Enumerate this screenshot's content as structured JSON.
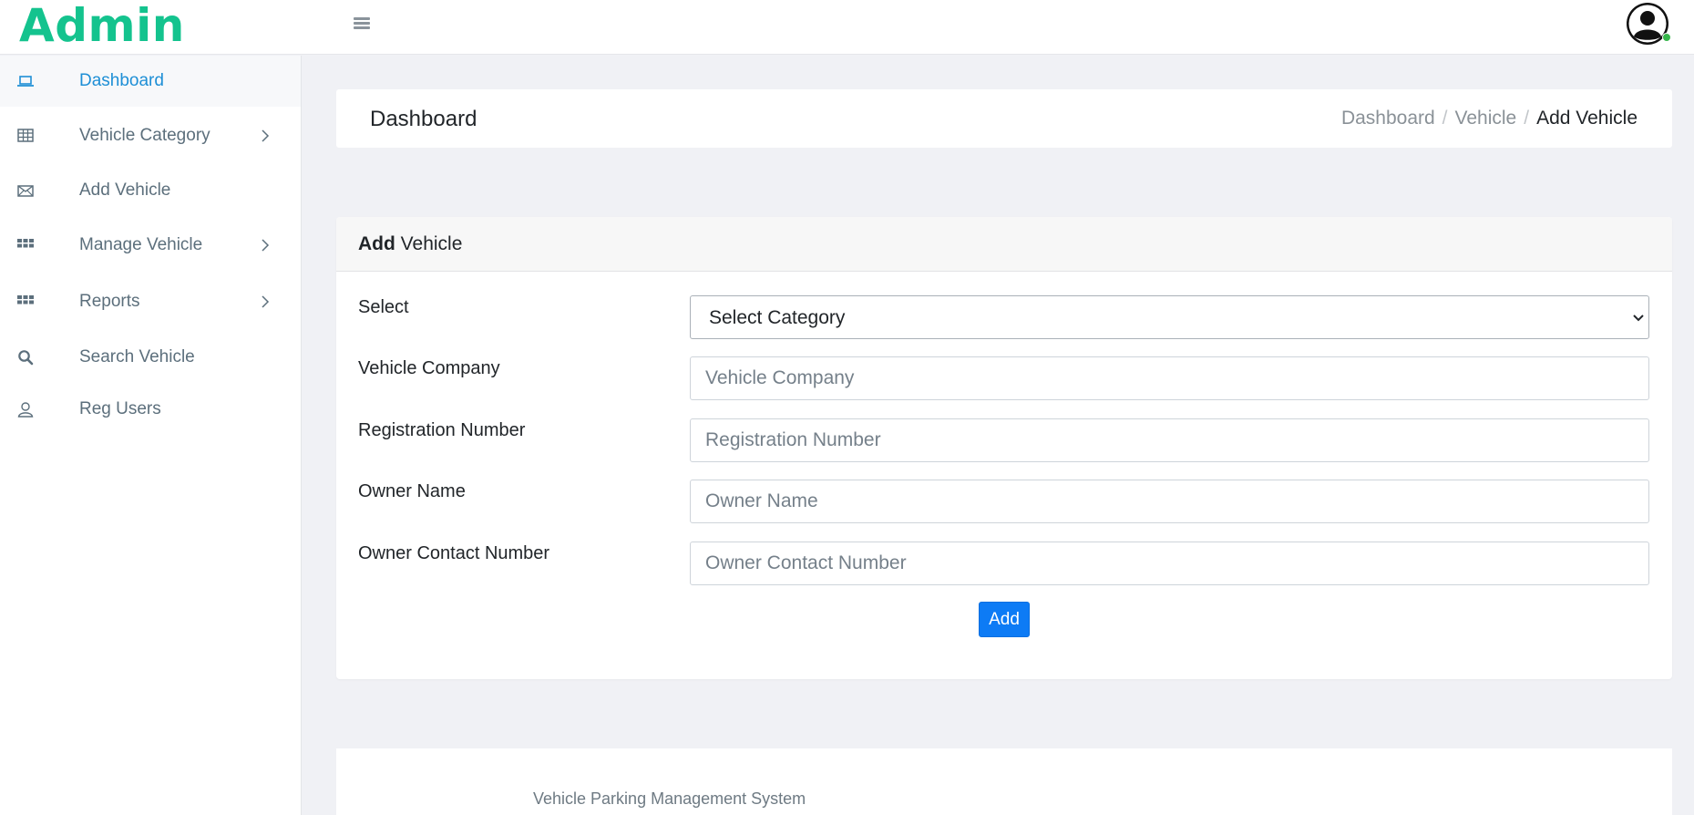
{
  "header": {
    "brand": "Admin",
    "menu_icon": "hamburger-icon",
    "avatar_icon": "user-avatar-icon"
  },
  "sidebar": {
    "items": [
      {
        "label": "Dashboard",
        "icon": "laptop-icon",
        "active": true
      },
      {
        "label": "Vehicle Category",
        "icon": "table-icon",
        "has_submenu": true
      },
      {
        "label": "Add Vehicle",
        "icon": "envelope-icon"
      },
      {
        "label": "Manage Vehicle",
        "icon": "grid-icon",
        "has_submenu": true
      },
      {
        "label": "Reports",
        "icon": "grid-icon",
        "has_submenu": true
      },
      {
        "label": "Search Vehicle",
        "icon": "search-icon"
      },
      {
        "label": "Reg Users",
        "icon": "user-icon"
      }
    ]
  },
  "page": {
    "title": "Dashboard",
    "breadcrumb": [
      "Dashboard",
      "Vehicle",
      "Add Vehicle"
    ]
  },
  "form": {
    "title_bold": "Add",
    "title_rest": "Vehicle",
    "fields": [
      {
        "label": "Select",
        "type": "select",
        "value": "Select Category"
      },
      {
        "label": "Vehicle Company",
        "placeholder": "Vehicle Company",
        "value": ""
      },
      {
        "label": "Registration Number",
        "placeholder": "Registration Number",
        "value": ""
      },
      {
        "label": "Owner Name",
        "placeholder": "Owner Name",
        "value": ""
      },
      {
        "label": "Owner Contact Number",
        "placeholder": "Owner Contact Number",
        "value": ""
      }
    ],
    "submit_label": "Add"
  },
  "footer": {
    "text": "Vehicle Parking Management System"
  },
  "colors": {
    "brand": "#14c38e",
    "active_nav": "#1e8fd6",
    "primary_button": "#0d7bf5",
    "online_status": "#35b54a",
    "background": "#f0f1f5"
  }
}
